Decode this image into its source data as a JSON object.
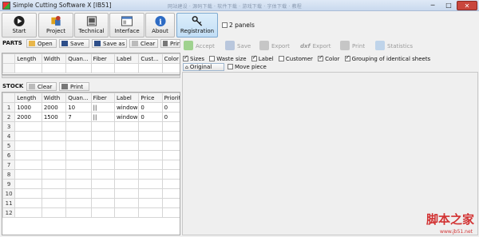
{
  "window": {
    "title": "Simple Cutting Software X [IB51]",
    "faded_title_text": "网站建设 · 源码下载 · 软件下载 · 游戏下载 · 字体下载 · 教程",
    "buttons": {
      "minimize": "─",
      "maximize": "□",
      "close": "✕"
    }
  },
  "toolbar": {
    "start": "Start",
    "project": "Project",
    "technical": "Technical",
    "interface": "Interface",
    "about": "About",
    "registration": "Registration",
    "two_panels": "2 panels"
  },
  "parts": {
    "title": "PARTS",
    "open": "Open",
    "save": "Save",
    "save_as": "Save as",
    "clear": "Clear",
    "print": "Print",
    "columns": [
      "Length",
      "Width",
      "Quan...",
      "Fiber",
      "Label",
      "Cust...",
      "Color"
    ]
  },
  "stock": {
    "title": "STOCK",
    "clear": "Clear",
    "print": "Print",
    "columns": [
      "Length",
      "Width",
      "Quan...",
      "Fiber",
      "Label",
      "Price",
      "Priority"
    ],
    "rows": [
      {
        "n": "1",
        "length": "1000",
        "width": "2000",
        "qty": "10",
        "fiber": "||",
        "label": "window",
        "price": "0",
        "priority": "0"
      },
      {
        "n": "2",
        "length": "2000",
        "width": "1500",
        "qty": "7",
        "fiber": "||",
        "label": "window",
        "price": "0",
        "priority": "0"
      },
      {
        "n": "3"
      },
      {
        "n": "4"
      },
      {
        "n": "5"
      },
      {
        "n": "6"
      },
      {
        "n": "7"
      },
      {
        "n": "8"
      },
      {
        "n": "9"
      },
      {
        "n": "10"
      },
      {
        "n": "11"
      },
      {
        "n": "12"
      }
    ]
  },
  "actions": {
    "accept": "Accept",
    "save": "Save",
    "export": "Export",
    "dxf_export": "Export",
    "dxf_prefix": "dxf",
    "print": "Print",
    "statistics": "Statistics"
  },
  "options": {
    "sizes": "Sizes",
    "waste_size": "Waste size",
    "label": "Label",
    "customer": "Customer",
    "color": "Color",
    "grouping": "Grouping of identical sheets",
    "original": "Original",
    "move_piece": "Move piece"
  },
  "watermark": {
    "text": "脚本之家",
    "url": "www.jb51.net"
  }
}
